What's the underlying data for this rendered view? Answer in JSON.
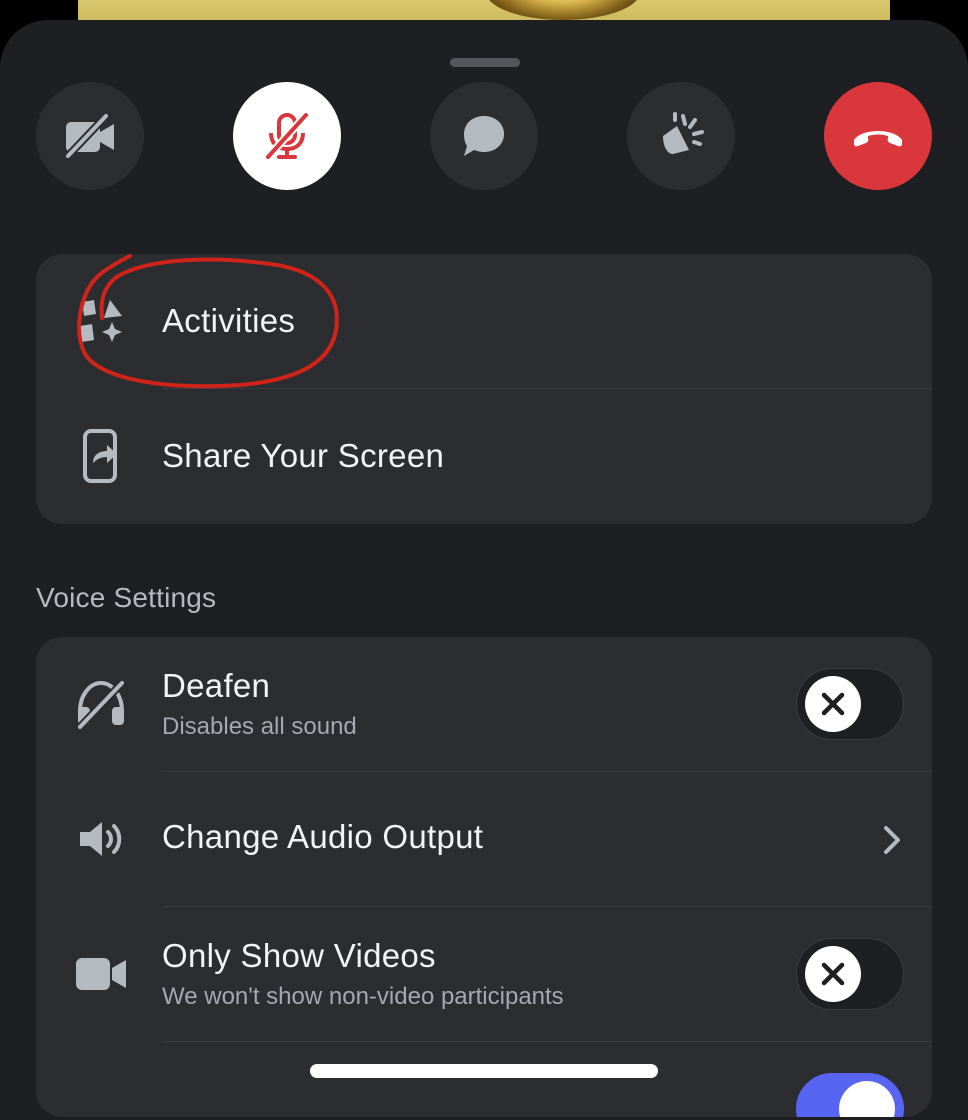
{
  "controls": [
    {
      "name": "camera-off",
      "icon": "camera-off-icon"
    },
    {
      "name": "mute",
      "icon": "mic-muted-icon"
    },
    {
      "name": "chat",
      "icon": "chat-bubble-icon"
    },
    {
      "name": "soundboard",
      "icon": "soundboard-icon"
    },
    {
      "name": "leave-call",
      "icon": "hang-up-icon"
    }
  ],
  "colors": {
    "sheet": "#1e1f22",
    "card": "#2b2d31",
    "danger": "#da373c",
    "accent": "#5865f2",
    "annotation": "#d0231a"
  },
  "actions": {
    "activities_label": "Activities",
    "share_screen_label": "Share Your Screen"
  },
  "voice_settings": {
    "header": "Voice Settings",
    "deafen": {
      "label": "Deafen",
      "description": "Disables all sound",
      "enabled": false
    },
    "audio_output": {
      "label": "Change Audio Output"
    },
    "only_videos": {
      "label": "Only Show Videos",
      "description": "We won't show non-video participants",
      "enabled": false
    },
    "next_toggle_enabled": true
  }
}
